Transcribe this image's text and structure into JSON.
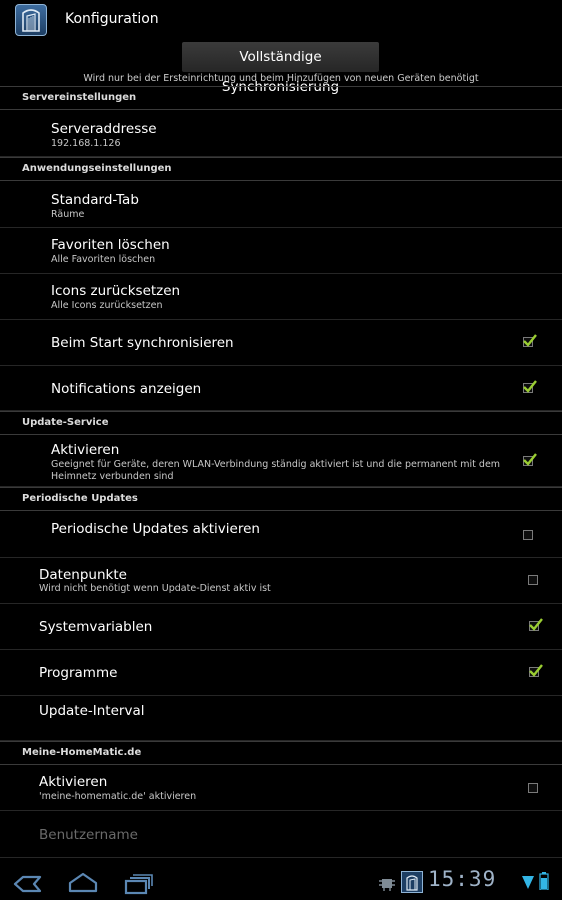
{
  "app": {
    "title": "Konfiguration"
  },
  "sync": {
    "button_label": "Vollständige Synchronisierung",
    "note": "Wird nur bei der Ersteinrichtung und beim Hinzufügen von neuen Geräten benötigt"
  },
  "sections": {
    "server": "Servereinstellungen",
    "app_settings": "Anwendungseinstellungen",
    "update_service": "Update-Service",
    "periodic": "Periodische Updates",
    "homematic": "Meine-HomeMatic.de"
  },
  "items": {
    "server_address": {
      "title": "Serveraddresse",
      "summary": "192.168.1.126"
    },
    "standard_tab": {
      "title": "Standard-Tab",
      "summary": "Räume"
    },
    "favorites": {
      "title": "Favoriten löschen",
      "summary": "Alle Favoriten löschen"
    },
    "icons_reset": {
      "title": "Icons zurücksetzen",
      "summary": "Alle Icons zurücksetzen"
    },
    "sync_on_start": {
      "title": "Beim Start synchronisieren",
      "checked": true
    },
    "notifications": {
      "title": "Notifications anzeigen",
      "checked": true
    },
    "update_activate": {
      "title": "Aktivieren",
      "summary": "Geeignet für Geräte, deren WLAN-Verbindung ständig aktiviert ist und die permanent mit dem Heimnetz verbunden sind",
      "checked": true
    },
    "periodic_activate": {
      "title": "Periodische Updates aktivieren",
      "checked": false
    },
    "datapoints": {
      "title": "Datenpunkte",
      "summary": "Wird nicht benötigt wenn Update-Dienst aktiv ist",
      "checked": false
    },
    "sysvars": {
      "title": "Systemvariablen",
      "checked": true
    },
    "programs": {
      "title": "Programme",
      "checked": true
    },
    "interval": {
      "title": "Update-Interval"
    },
    "hm_activate": {
      "title": "Aktivieren",
      "summary": "'meine-homematic.de' aktivieren",
      "checked": false
    },
    "username": {
      "title": "Benutzername"
    }
  },
  "status": {
    "time": "15:39"
  },
  "colors": {
    "check": "#9acd32",
    "accent": "#33b5e5"
  }
}
